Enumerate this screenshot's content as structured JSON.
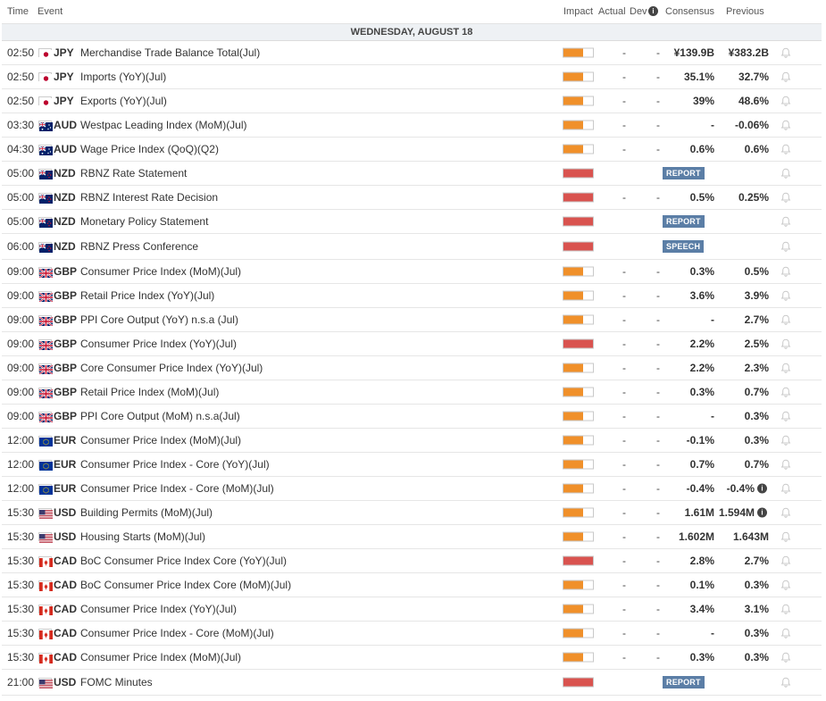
{
  "header": {
    "time": "Time",
    "event": "Event",
    "impact": "Impact",
    "actual": "Actual",
    "dev": "Dev",
    "info_glyph": "i",
    "consensus": "Consensus",
    "previous": "Previous"
  },
  "day_label": "WEDNESDAY, AUGUST 18",
  "colors": {
    "high": "#d9534f",
    "medium": "#f0902a",
    "badge": "#5b7ea6"
  },
  "rows": [
    {
      "time": "02:50",
      "flag": "jp",
      "cur": "JPY",
      "event": "Merchandise Trade Balance Total(Jul)",
      "impact": "medium",
      "actual": "-",
      "dev": "-",
      "cons": "¥139.9B",
      "prev": "¥383.2B"
    },
    {
      "time": "02:50",
      "flag": "jp",
      "cur": "JPY",
      "event": "Imports (YoY)(Jul)",
      "impact": "medium",
      "actual": "-",
      "dev": "-",
      "cons": "35.1%",
      "prev": "32.7%"
    },
    {
      "time": "02:50",
      "flag": "jp",
      "cur": "JPY",
      "event": "Exports (YoY)(Jul)",
      "impact": "medium",
      "actual": "-",
      "dev": "-",
      "cons": "39%",
      "prev": "48.6%"
    },
    {
      "time": "03:30",
      "flag": "au",
      "cur": "AUD",
      "event": "Westpac Leading Index (MoM)(Jul)",
      "impact": "medium",
      "actual": "-",
      "dev": "-",
      "cons": "-",
      "prev": "-0.06%"
    },
    {
      "time": "04:30",
      "flag": "au",
      "cur": "AUD",
      "event": "Wage Price Index (QoQ)(Q2)",
      "impact": "medium",
      "actual": "-",
      "dev": "-",
      "cons": "0.6%",
      "prev": "0.6%"
    },
    {
      "time": "05:00",
      "flag": "nz",
      "cur": "NZD",
      "event": "RBNZ Rate Statement",
      "impact": "high",
      "badge": "REPORT"
    },
    {
      "time": "05:00",
      "flag": "nz",
      "cur": "NZD",
      "event": "RBNZ Interest Rate Decision",
      "impact": "high",
      "actual": "-",
      "dev": "-",
      "cons": "0.5%",
      "prev": "0.25%"
    },
    {
      "time": "05:00",
      "flag": "nz",
      "cur": "NZD",
      "event": "Monetary Policy Statement",
      "impact": "high",
      "badge": "REPORT"
    },
    {
      "time": "06:00",
      "flag": "nz",
      "cur": "NZD",
      "event": "RBNZ Press Conference",
      "impact": "high",
      "badge": "SPEECH"
    },
    {
      "time": "09:00",
      "flag": "gb",
      "cur": "GBP",
      "event": "Consumer Price Index (MoM)(Jul)",
      "impact": "medium",
      "actual": "-",
      "dev": "-",
      "cons": "0.3%",
      "prev": "0.5%"
    },
    {
      "time": "09:00",
      "flag": "gb",
      "cur": "GBP",
      "event": "Retail Price Index (YoY)(Jul)",
      "impact": "medium",
      "actual": "-",
      "dev": "-",
      "cons": "3.6%",
      "prev": "3.9%"
    },
    {
      "time": "09:00",
      "flag": "gb",
      "cur": "GBP",
      "event": "PPI Core Output (YoY) n.s.a (Jul)",
      "impact": "medium",
      "actual": "-",
      "dev": "-",
      "cons": "-",
      "prev": "2.7%"
    },
    {
      "time": "09:00",
      "flag": "gb",
      "cur": "GBP",
      "event": "Consumer Price Index (YoY)(Jul)",
      "impact": "high",
      "actual": "-",
      "dev": "-",
      "cons": "2.2%",
      "prev": "2.5%"
    },
    {
      "time": "09:00",
      "flag": "gb",
      "cur": "GBP",
      "event": "Core Consumer Price Index (YoY)(Jul)",
      "impact": "medium",
      "actual": "-",
      "dev": "-",
      "cons": "2.2%",
      "prev": "2.3%"
    },
    {
      "time": "09:00",
      "flag": "gb",
      "cur": "GBP",
      "event": "Retail Price Index (MoM)(Jul)",
      "impact": "medium",
      "actual": "-",
      "dev": "-",
      "cons": "0.3%",
      "prev": "0.7%"
    },
    {
      "time": "09:00",
      "flag": "gb",
      "cur": "GBP",
      "event": "PPI Core Output (MoM) n.s.a(Jul)",
      "impact": "medium",
      "actual": "-",
      "dev": "-",
      "cons": "-",
      "prev": "0.3%"
    },
    {
      "time": "12:00",
      "flag": "eu",
      "cur": "EUR",
      "event": "Consumer Price Index (MoM)(Jul)",
      "impact": "medium",
      "actual": "-",
      "dev": "-",
      "cons": "-0.1%",
      "prev": "0.3%"
    },
    {
      "time": "12:00",
      "flag": "eu",
      "cur": "EUR",
      "event": "Consumer Price Index - Core (YoY)(Jul)",
      "impact": "medium",
      "actual": "-",
      "dev": "-",
      "cons": "0.7%",
      "prev": "0.7%"
    },
    {
      "time": "12:00",
      "flag": "eu",
      "cur": "EUR",
      "event": "Consumer Price Index - Core (MoM)(Jul)",
      "impact": "medium",
      "actual": "-",
      "dev": "-",
      "cons": "-0.4%",
      "prev": "-0.4%",
      "info": true
    },
    {
      "time": "15:30",
      "flag": "us",
      "cur": "USD",
      "event": "Building Permits (MoM)(Jul)",
      "impact": "medium",
      "actual": "-",
      "dev": "-",
      "cons": "1.61M",
      "prev": "1.594M",
      "info": true
    },
    {
      "time": "15:30",
      "flag": "us",
      "cur": "USD",
      "event": "Housing Starts (MoM)(Jul)",
      "impact": "medium",
      "actual": "-",
      "dev": "-",
      "cons": "1.602M",
      "prev": "1.643M"
    },
    {
      "time": "15:30",
      "flag": "ca",
      "cur": "CAD",
      "event": "BoC Consumer Price Index Core (YoY)(Jul)",
      "impact": "high",
      "actual": "-",
      "dev": "-",
      "cons": "2.8%",
      "prev": "2.7%"
    },
    {
      "time": "15:30",
      "flag": "ca",
      "cur": "CAD",
      "event": "BoC Consumer Price Index Core (MoM)(Jul)",
      "impact": "medium",
      "actual": "-",
      "dev": "-",
      "cons": "0.1%",
      "prev": "0.3%"
    },
    {
      "time": "15:30",
      "flag": "ca",
      "cur": "CAD",
      "event": "Consumer Price Index (YoY)(Jul)",
      "impact": "medium",
      "actual": "-",
      "dev": "-",
      "cons": "3.4%",
      "prev": "3.1%"
    },
    {
      "time": "15:30",
      "flag": "ca",
      "cur": "CAD",
      "event": "Consumer Price Index - Core (MoM)(Jul)",
      "impact": "medium",
      "actual": "-",
      "dev": "-",
      "cons": "-",
      "prev": "0.3%"
    },
    {
      "time": "15:30",
      "flag": "ca",
      "cur": "CAD",
      "event": "Consumer Price Index (MoM)(Jul)",
      "impact": "medium",
      "actual": "-",
      "dev": "-",
      "cons": "0.3%",
      "prev": "0.3%"
    },
    {
      "time": "21:00",
      "flag": "us",
      "cur": "USD",
      "event": "FOMC Minutes",
      "impact": "high",
      "badge": "REPORT"
    }
  ]
}
